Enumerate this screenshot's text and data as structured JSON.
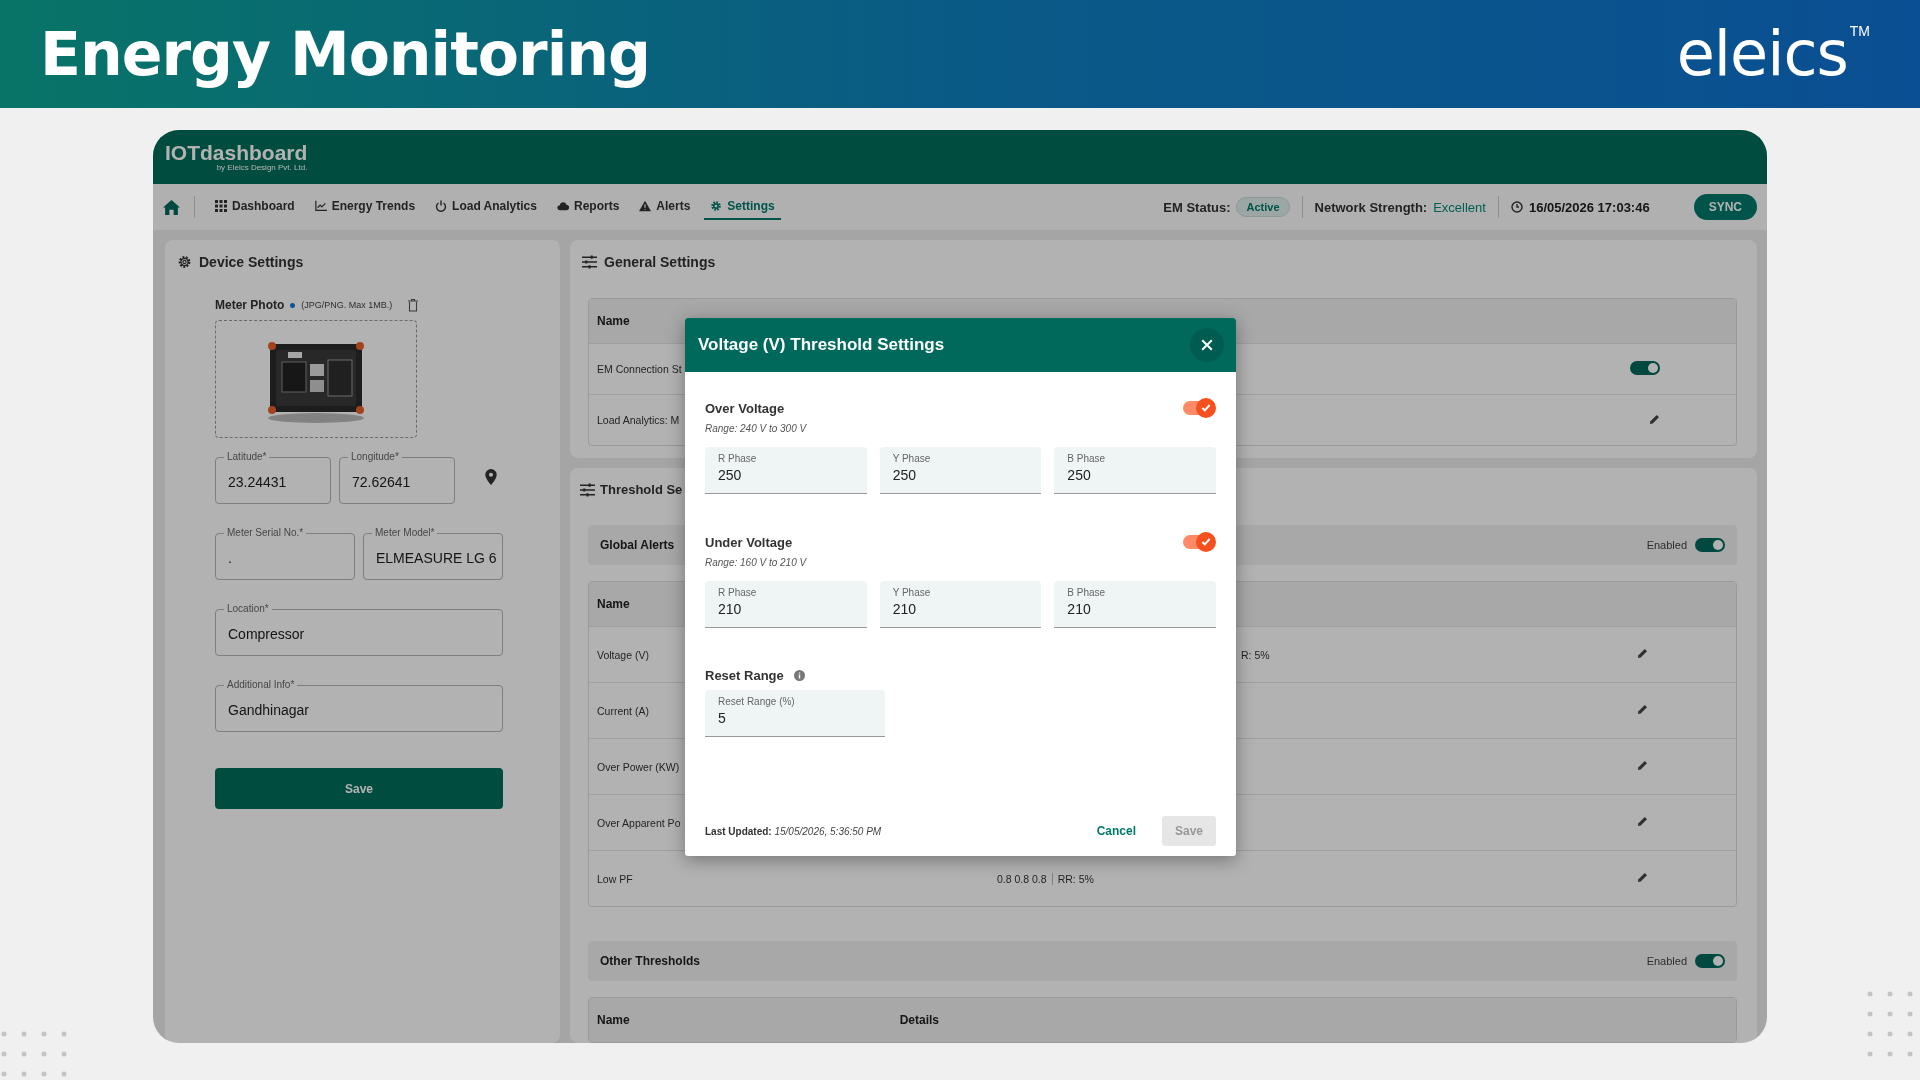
{
  "banner": {
    "title": "Energy Monitoring",
    "logo": "eleics",
    "logo_mark": "TM"
  },
  "app": {
    "logo": "IOTdashboard",
    "logo_sub": "by Eleics Design Pvt. Ltd.",
    "nav": [
      {
        "label": "Dashboard",
        "selected": false
      },
      {
        "label": "Energy Trends",
        "selected": false
      },
      {
        "label": "Load Analytics",
        "selected": false
      },
      {
        "label": "Reports",
        "selected": false
      },
      {
        "label": "Alerts",
        "selected": false
      },
      {
        "label": "Settings",
        "selected": true
      }
    ],
    "status": {
      "em_label": "EM Status:",
      "em_value": "Active",
      "network_label": "Network Strength:",
      "network_value": "Excellent",
      "datetime": "16/05/2026 17:03:46",
      "sync": "SYNC"
    }
  },
  "device_settings": {
    "title": "Device Settings",
    "photo_label": "Meter Photo",
    "photo_hint": "(JPG/PNG. Max 1MB.)",
    "fields": [
      {
        "label": "Latitude*",
        "value": "23.24431",
        "kind": "short"
      },
      {
        "label": "Longitude*",
        "value": "72.62641",
        "kind": "short"
      },
      {
        "label": "Meter Serial No.*",
        "value": ".",
        "kind": "half"
      },
      {
        "label": "Meter Model*",
        "value": "ELMEASURE LG 6",
        "kind": "half"
      },
      {
        "label": "Location*",
        "value": "Compressor",
        "kind": "full"
      },
      {
        "label": "Additional Info*",
        "value": "Gandhinagar",
        "kind": "full"
      }
    ],
    "save": "Save"
  },
  "general_settings": {
    "title": "General Settings",
    "columns": [
      "Name"
    ],
    "rows": [
      {
        "name": "EM Connection St",
        "kind": "toggle",
        "on": true
      },
      {
        "name": "Load Analytics: M",
        "kind": "edit"
      }
    ]
  },
  "threshold_settings": {
    "title": "Threshold Se",
    "global_alerts": {
      "title": "Global Alerts",
      "enabled_label": "Enabled",
      "on": true,
      "columns": [
        "Name"
      ],
      "rows": [
        {
          "name": "Voltage (V)",
          "details": "R: 5%",
          "cut": true
        },
        {
          "name": "Current (A)"
        },
        {
          "name": "Over Power (KW)"
        },
        {
          "name": "Over Apparent Po"
        },
        {
          "name": "Low PF",
          "details": "0.8 0.8 0.8",
          "rr": "RR: 5%"
        }
      ]
    },
    "other": {
      "title": "Other Thresholds",
      "enabled_label": "Enabled",
      "on": true,
      "columns": [
        "Name",
        "Details"
      ]
    }
  },
  "modal": {
    "title": "Voltage (V) Threshold Settings",
    "sections": [
      {
        "title": "Over Voltage",
        "range": "Range: 240 V to 300 V",
        "on": true,
        "fields": [
          {
            "label": "R Phase",
            "value": "250"
          },
          {
            "label": "Y Phase",
            "value": "250"
          },
          {
            "label": "B Phase",
            "value": "250"
          }
        ]
      },
      {
        "title": "Under Voltage",
        "range": "Range: 160 V to 210 V",
        "on": true,
        "fields": [
          {
            "label": "R Phase",
            "value": "210"
          },
          {
            "label": "Y Phase",
            "value": "210"
          },
          {
            "label": "B Phase",
            "value": "210"
          }
        ]
      }
    ],
    "reset": {
      "title": "Reset Range",
      "label": "Reset Range (%)",
      "value": "5"
    },
    "last_updated_label": "Last Updated:",
    "last_updated": "15/05/2026, 5:36:50 PM",
    "cancel": "Cancel",
    "save": "Save",
    "save_disabled": true
  }
}
